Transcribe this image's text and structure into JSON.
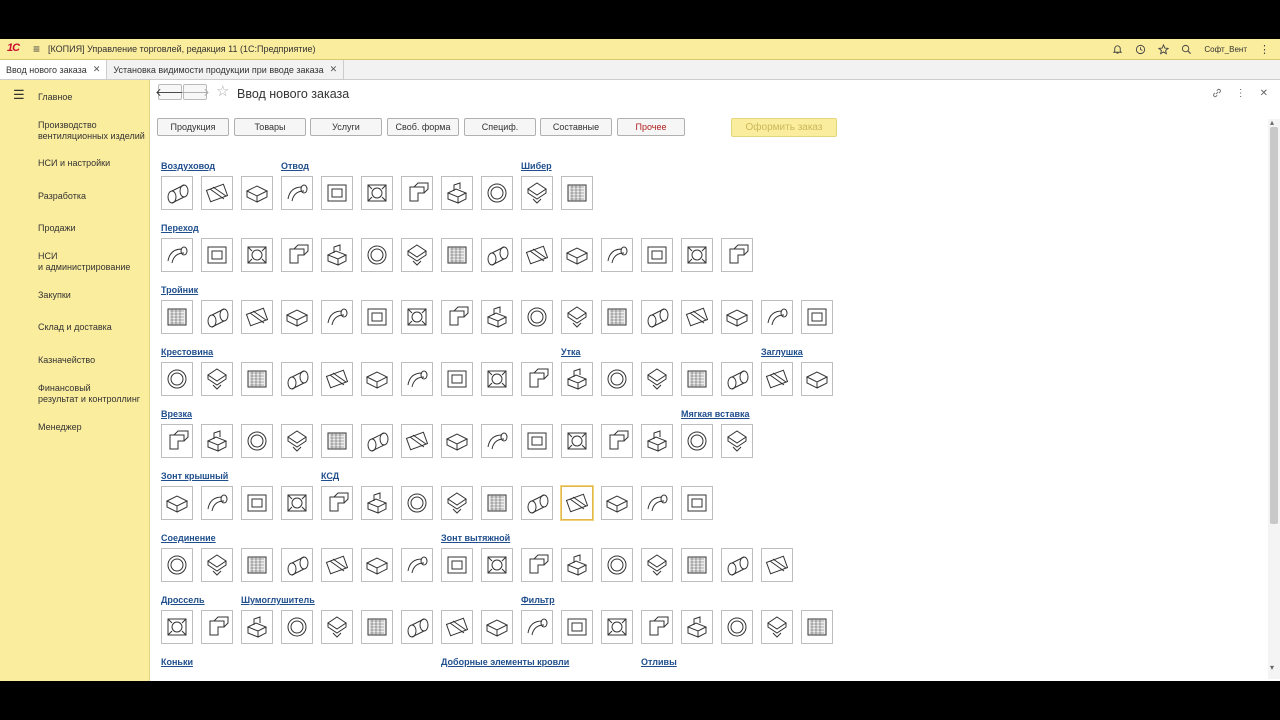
{
  "app": {
    "logo": "1С",
    "title": "[КОПИЯ] Управление торговлей, редакция 11  (1С:Предприятие)",
    "user": "Софт_Вент"
  },
  "tabs": [
    {
      "label": "Ввод нового заказа"
    },
    {
      "label": "Установка видимости продукции при вводе заказа"
    }
  ],
  "sidebar": {
    "items": [
      {
        "label": "Главное"
      },
      {
        "label": "Производство\nвентиляционных изделий"
      },
      {
        "label": "НСИ и настройки"
      },
      {
        "label": "Разработка"
      },
      {
        "label": "Продажи"
      },
      {
        "label": "НСИ\nи администрирование"
      },
      {
        "label": "Закупки"
      },
      {
        "label": "Склад и доставка"
      },
      {
        "label": "Казначейство"
      },
      {
        "label": "Финансовый\nрезультат и контроллинг"
      },
      {
        "label": "Менеджер"
      }
    ]
  },
  "page": {
    "title": "Ввод нового заказа"
  },
  "categories": [
    {
      "label": "Продукция"
    },
    {
      "label": "Товары"
    },
    {
      "label": "Услуги"
    },
    {
      "label": "Своб. форма"
    },
    {
      "label": "Специф."
    },
    {
      "label": "Составные"
    },
    {
      "label": "Прочее"
    }
  ],
  "order_button": "Оформить заказ",
  "groups": {
    "vozdukhovod": "Воздуховод",
    "otvod": "Отвод",
    "shiber": "Шибер",
    "perekhod": "Переход",
    "troynik": "Тройник",
    "krestovina": "Крестовина",
    "utka": "Утка",
    "zaglushka": "Заглушка",
    "vrezka": "Врезка",
    "myagkaya": "Мягкая вставка",
    "zont_kryshny": "Зонт крышный",
    "ksd": "КСД",
    "soedinenie": "Соединение",
    "zont_vytyazhnoy": "Зонт вытяжной",
    "drossel": "Дроссель",
    "shumoglushitel": "Шумоглушитель",
    "filtr": "Фильтр",
    "konki": "Коньки",
    "dobornye": "Доборные элементы кровли",
    "otlivy": "Отливы"
  },
  "icons": {
    "tab_close": "close-icon",
    "bell": "bell-icon",
    "history": "history-icon",
    "favorite": "star-icon",
    "search": "search-icon",
    "more": "more-icon"
  }
}
